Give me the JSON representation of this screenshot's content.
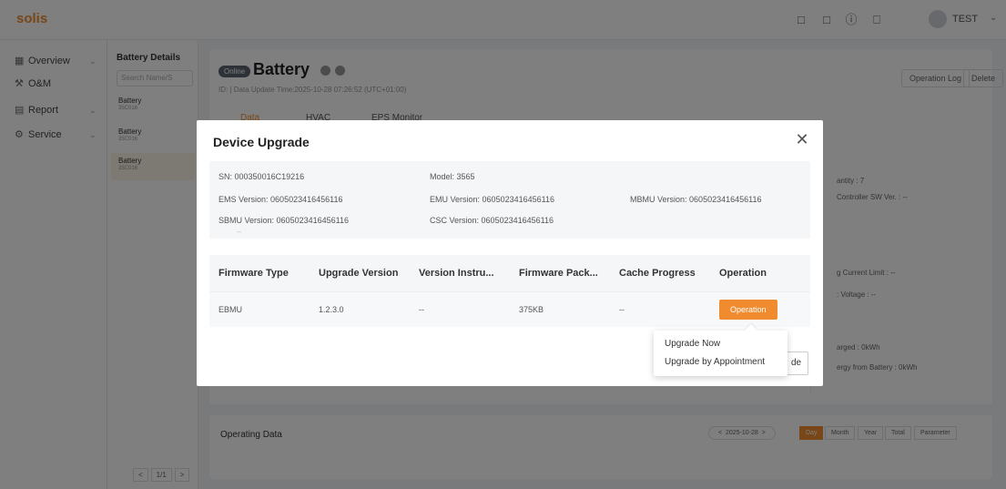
{
  "app": {
    "logo": "solis",
    "user": "TEST"
  },
  "sidenav": {
    "items": [
      {
        "label": "Overview",
        "icon": "grid-icon"
      },
      {
        "label": "O&M",
        "icon": "tools-icon"
      },
      {
        "label": "Report",
        "icon": "report-icon"
      },
      {
        "label": "Service",
        "icon": "service-icon"
      }
    ]
  },
  "devlist": {
    "title": "Battery Details",
    "search_placeholder": "Search Name/S",
    "items": [
      {
        "name": "Battery",
        "sn": "35C016"
      },
      {
        "name": "Battery",
        "sn": "35C016"
      },
      {
        "name": "Battery",
        "sn": "35C016"
      }
    ],
    "pager": "1/1"
  },
  "main": {
    "status": "Online",
    "title": "Battery",
    "id_line": "ID:     | Data Update Time:2025-10-28 07:26:52 (UTC+01:00)",
    "operation_log": "Operation Log",
    "delete": "Delete",
    "tabs": [
      "Data",
      "HVAC",
      "EPS Monitor"
    ],
    "right_panel": [
      "antity : 7",
      "Controller SW Ver. : --",
      "g Current Limit : --",
      ": Voltage : --",
      "arged : 0kWh",
      "ergy from Battery : 0kWh"
    ],
    "operating_data": "Operating Data",
    "date": "2025-10-28",
    "ranges": [
      "Day",
      "Month",
      "Year",
      "Total",
      "Parameter"
    ]
  },
  "modal": {
    "title": "Device Upgrade",
    "info": {
      "sn_label": "SN:",
      "sn": "000350016C19216",
      "model_label": "Model:",
      "model": "3565",
      "ems_label": "EMS Version:",
      "ems": "0605023416456116",
      "emu_label": "EMU Version:",
      "emu": "0605023416456116",
      "mbmu_label": "MBMU Version:",
      "mbmu": "0605023416456116",
      "sbmu_label": "SBMU Version:",
      "sbmu": "0605023416456116",
      "csc_label": "CSC Version:",
      "csc": "0605023416456116",
      "dash": "--"
    },
    "table": {
      "headers": [
        "Firmware Type",
        "Upgrade Version",
        "Version Instru...",
        "Firmware Pack...",
        "Cache Progress",
        "Operation"
      ],
      "row": {
        "firmware_type": "EBMU",
        "upgrade_version": "1.2.3.0",
        "version_instructions": "--",
        "firmware_package": "375KB",
        "cache_progress": "--",
        "operation": "Operation"
      }
    },
    "dropdown": [
      "Upgrade Now",
      "Upgrade by Appointment"
    ],
    "upgrade_button_peek": "de"
  }
}
